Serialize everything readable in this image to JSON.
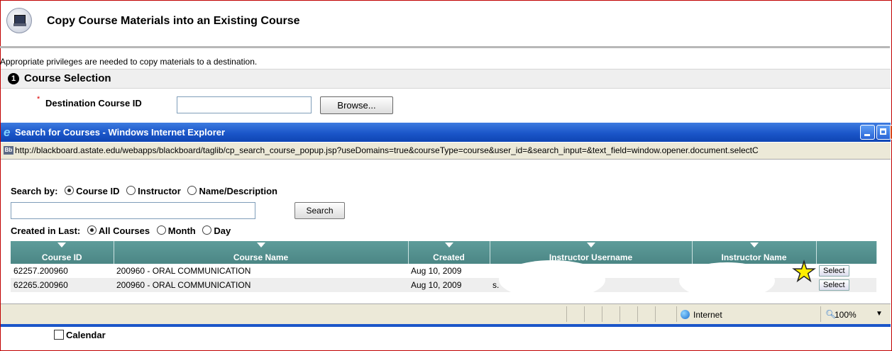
{
  "header": {
    "title": "Copy Course Materials into an Existing Course"
  },
  "notice": "Appropriate privileges are needed to copy materials to a destination.",
  "section": {
    "number": "1",
    "title": "Course Selection"
  },
  "destination": {
    "required_mark": "*",
    "label": "Destination Course ID",
    "value": "",
    "browse_label": "Browse..."
  },
  "popup": {
    "window_title": "Search for Courses - Windows Internet Explorer",
    "url": "http://blackboard.astate.edu/webapps/blackboard/taglib/cp_search_course_popup.jsp?useDomains=true&courseType=course&user_id=&search_input=&text_field=window.opener.document.selectC",
    "search_by_label": "Search by:",
    "search_by_options": [
      "Course ID",
      "Instructor",
      "Name/Description"
    ],
    "search_value": "",
    "search_button": "Search",
    "created_label": "Created in Last:",
    "created_options": [
      "All Courses",
      "Month",
      "Day"
    ],
    "table": {
      "columns": [
        "Course ID",
        "Course Name",
        "Created",
        "Instructor Username",
        "Instructor Name",
        ""
      ],
      "rows": [
        {
          "course_id": "62257.200960",
          "course_name": "200960 - ORAL COMMUNICATION",
          "created": "Aug 10, 2009",
          "username": "",
          "name": "",
          "action": "Select"
        },
        {
          "course_id": "62265.200960",
          "course_name": "200960 - ORAL COMMUNICATION",
          "created": "Aug 10, 2009",
          "username": "s.",
          "name": "",
          "action": "Select"
        }
      ]
    },
    "status": {
      "zone": "Internet",
      "zoom": "100%"
    }
  },
  "calendar_label": "Calendar",
  "colors": {
    "accent": "#1b56c9",
    "table_header": "#4b8685",
    "frame": "#c00000"
  }
}
